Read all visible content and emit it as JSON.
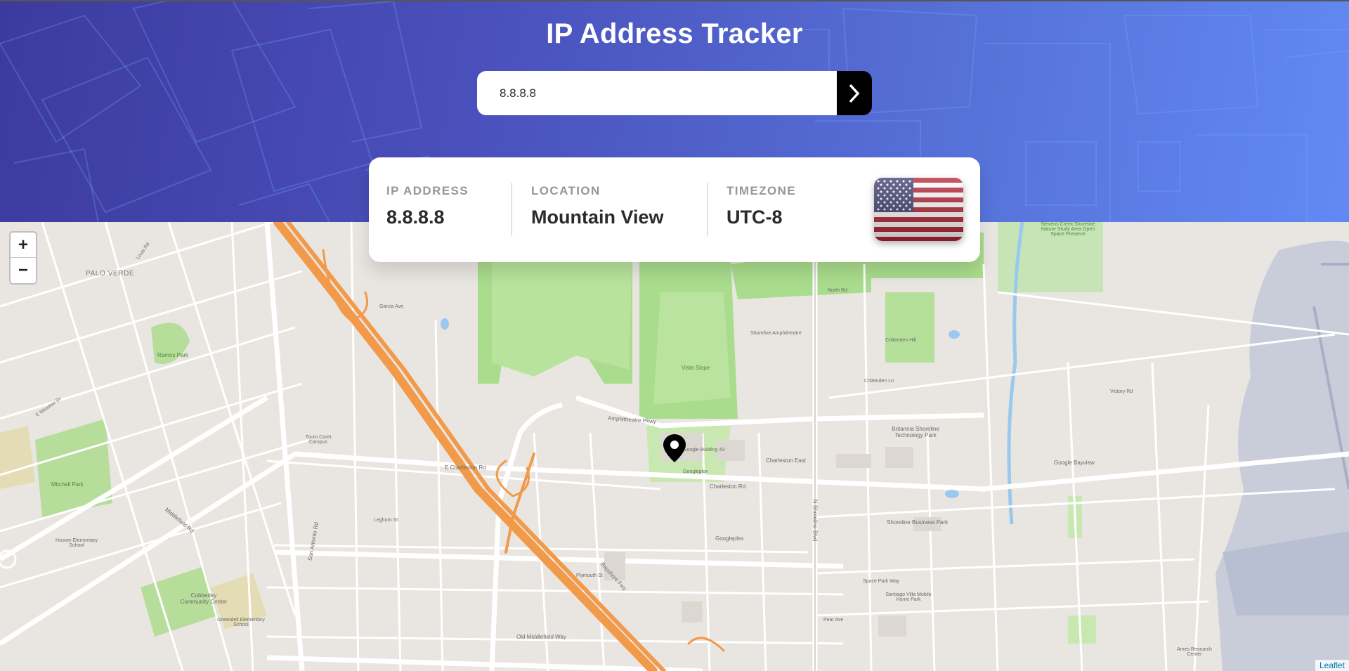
{
  "header": {
    "title": "IP Address Tracker",
    "search_value": "8.8.8.8"
  },
  "info": {
    "ip_label": "IP ADDRESS",
    "ip_value": "8.8.8.8",
    "location_label": "LOCATION",
    "location_value": "Mountain View",
    "timezone_label": "TIMEZONE",
    "timezone_value": "UTC-8",
    "flag_icon": "us-flag"
  },
  "map": {
    "zoom_in": "+",
    "zoom_out": "−",
    "attribution": "Leaflet",
    "labels": {
      "palo_verde": "PALO VERDE",
      "vista_slope": "Vista Slope",
      "shoreline_amph": "Shoreline Amphitheatre",
      "crittenden_hill": "Crittenden Hill",
      "google_bldg": "Google Building 43",
      "googleplex": "Googleplex",
      "googleplex2": "Googleplex",
      "charleston_east": "Charleston East",
      "britannia": "Britannia Shoreline Technology Park",
      "google_bayview": "Google Bayview",
      "shoreline_park": "Shoreline Business Park",
      "mitchell_park": "Mitchell Park",
      "ramos_park": "Ramos Park",
      "cubberley": "Cubberley Community Center",
      "greendell": "Greendell Elementary School",
      "hoover": "Hoover Elementary School",
      "touro": "Touro Coret Campus",
      "stevens_creek": "Stevens Creek Shoreline Nature Study Area Open Space Preserve",
      "amphitheatre_pkwy": "Amphitheatre Pkwy",
      "charleston_rd": "Charleston Rd",
      "e_charleston": "E Charleston Rd",
      "middlefield": "Middlefield Rd",
      "bayshore": "Bayshore Fwy",
      "n_shoreline": "N Shoreline Blvd",
      "san_antonio": "San Antonio Rd",
      "crittenden_ln": "Crittenden Ln",
      "north_rd": "North Rd",
      "old_middlefield": "Old Middlefield Way",
      "plymouth": "Plymouth St",
      "garcia": "Garcia Ave",
      "louis": "Louis Rd",
      "e_meadow": "E Meadow Dr",
      "victory": "Victory Rd",
      "leghorn": "Leghorn St",
      "pear_ave": "Pear Ave",
      "sweetwater": "Space Park Way",
      "santiago": "Santiago Villa Mobile Home Park",
      "ames": "Ames Research Center"
    }
  }
}
